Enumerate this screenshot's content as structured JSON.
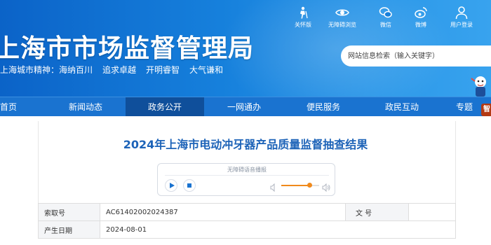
{
  "header": {
    "site_title": "上海市市场监督管理局",
    "slogan": [
      "上海城市精神：海纳百川",
      "追求卓越",
      "开明睿智",
      "大气谦和"
    ],
    "tools": [
      {
        "label": "关怀版",
        "icon": "elderly-care-icon"
      },
      {
        "label": "无障碍浏览",
        "icon": "eye-icon"
      },
      {
        "label": "微信",
        "icon": "wechat-icon"
      },
      {
        "label": "微博",
        "icon": "weibo-icon"
      },
      {
        "label": "用户登录",
        "icon": "user-icon"
      }
    ],
    "search": {
      "placeholder": "网站信息检索（输入关键字）"
    }
  },
  "nav": {
    "items": [
      "首页",
      "新闻动态",
      "政务公开",
      "一网通办",
      "便民服务",
      "政民互动",
      "专题"
    ],
    "active": "政务公开",
    "badge": "智"
  },
  "article": {
    "title": "2024年上海市电动冲牙器产品质量监督抽查结果",
    "player": {
      "label": "无障碍语音播报",
      "volume_fraction": 0.75,
      "accent": "#f08a1c"
    },
    "meta": {
      "index_label": "索取号",
      "index_value": "AC61402002024387",
      "doc_no_label": "文  号",
      "doc_no_value": "",
      "date_label": "产生日期",
      "date_value": "2024-08-01"
    }
  },
  "colors": {
    "header_blue": "#1680dc",
    "nav_blue": "#1a73d0",
    "nav_active": "#0f4f9b",
    "title_blue": "#1d63b8"
  }
}
